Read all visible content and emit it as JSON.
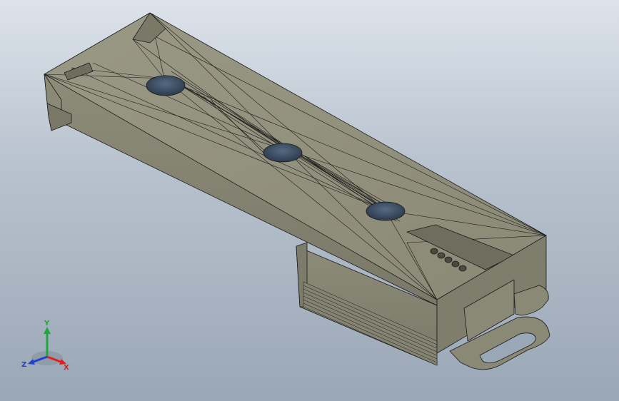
{
  "viewport": {
    "background_top": "#dde3ea",
    "background_bottom": "#9aa7b6"
  },
  "model": {
    "face_color": "#8e8d7a",
    "edge_color": "#1a1a1a",
    "hole_color": "#3a4a5e"
  },
  "triad": {
    "x_label": "X",
    "y_label": "Y",
    "z_label": "Z",
    "x_color": "#e02020",
    "y_color": "#1fa83a",
    "z_color": "#2040d0"
  }
}
